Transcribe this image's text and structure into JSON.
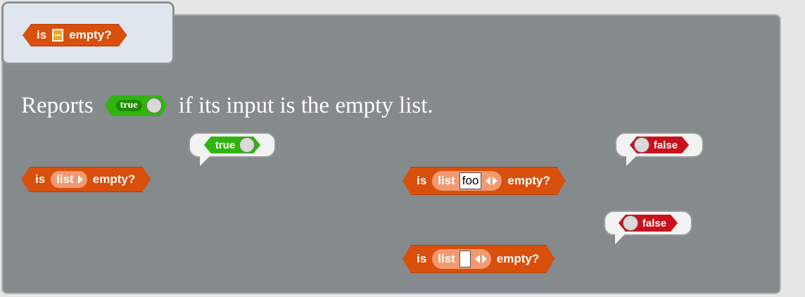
{
  "help": {
    "header_block": {
      "prefix": "is",
      "suffix": "empty?"
    },
    "description": {
      "before": "Reports",
      "true_label": "true",
      "after": "if its input is the empty list."
    },
    "examples": [
      {
        "prefix": "is",
        "list_label": "list",
        "slot_text": null,
        "suffix": "empty?",
        "result": "true"
      },
      {
        "prefix": "is",
        "list_label": "list",
        "slot_text": "foo",
        "suffix": "empty?",
        "result": "false"
      },
      {
        "prefix": "is",
        "list_label": "list",
        "slot_text": "",
        "suffix": "empty?",
        "result": "false"
      }
    ]
  },
  "colors": {
    "operator_block": "#d94f0c",
    "true": "#2fb50e",
    "false": "#c8111a",
    "panel": "#858a8c"
  }
}
